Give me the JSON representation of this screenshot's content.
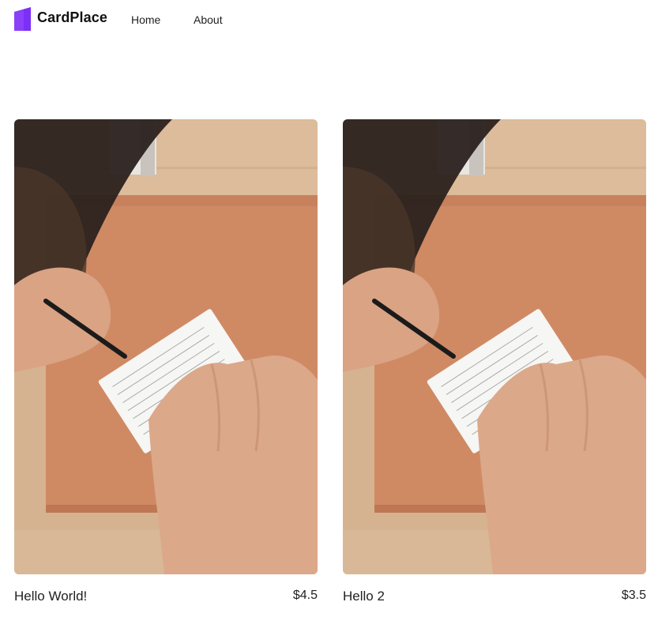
{
  "header": {
    "brand": "CardPlace",
    "logo_icon": "card-logo-icon",
    "accent_color": "#7b2ff7",
    "nav": [
      {
        "label": "Home"
      },
      {
        "label": "About"
      }
    ]
  },
  "products": [
    {
      "title": "Hello World!",
      "price": "$4.5",
      "image": "hand-writing-on-note-card-photo"
    },
    {
      "title": "Hello 2",
      "price": "$3.5",
      "image": "hand-writing-on-note-card-photo"
    }
  ]
}
